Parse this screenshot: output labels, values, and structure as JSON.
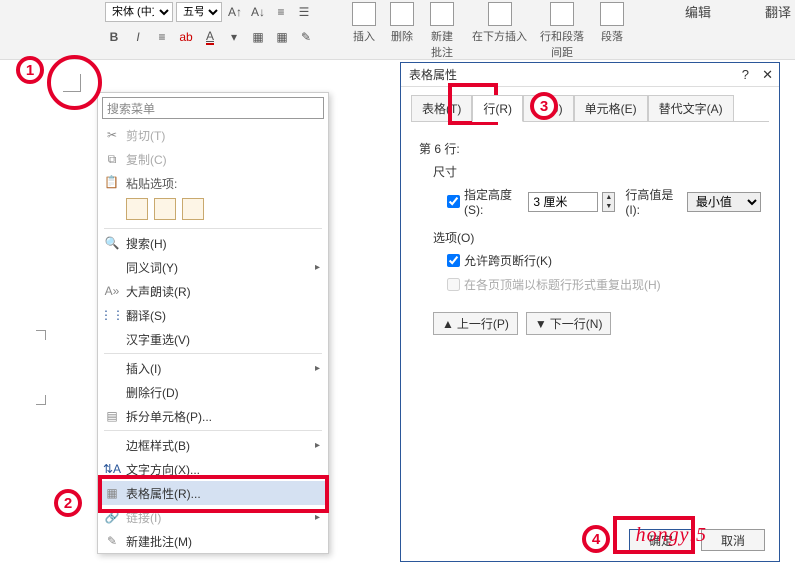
{
  "ribbon": {
    "font_name": "宋体 (中文",
    "font_size": "五号",
    "groups": {
      "insert": "插入",
      "delete": "删除",
      "new_comment": "新建\n批注",
      "insert_below": "在下方插入",
      "row_spacing": "行和段落\n间距",
      "paragraph": "段落"
    },
    "tabs": {
      "edit": "编辑",
      "trans": "翻译"
    }
  },
  "context_menu": {
    "search_placeholder": "搜索菜单",
    "cut": "剪切(T)",
    "copy": "复制(C)",
    "paste_label": "粘贴选项:",
    "search": "搜索(H)",
    "synonyms": "同义词(Y)",
    "read_aloud": "大声朗读(R)",
    "translate": "翻译(S)",
    "cjk_reselect": "汉字重选(V)",
    "insert": "插入(I)",
    "delete_row": "删除行(D)",
    "split_cells": "拆分单元格(P)...",
    "border_style": "边框样式(B)",
    "text_direction": "文字方向(X)...",
    "table_props": "表格属性(R)...",
    "link": "链接(I)",
    "new_comment": "新建批注(M)"
  },
  "dialog": {
    "title": "表格属性",
    "tabs": {
      "table": "表格(T)",
      "row": "行(R)",
      "column": "列(U)",
      "cell": "单元格(E)",
      "alt_text": "替代文字(A)"
    },
    "row_header": "第 6 行:",
    "size_label": "尺寸",
    "spec_height": "指定高度(S):",
    "height_value": "3 厘米",
    "height_is": "行高值是(I):",
    "height_mode": "最小值",
    "options_label": "选项(O)",
    "allow_break": "允许跨页断行(K)",
    "repeat_header": "在各页顶端以标题行形式重复出现(H)",
    "prev_row": "上一行(P)",
    "next_row": "下一行(N)",
    "ok": "确定",
    "cancel": "取消"
  },
  "watermark": "hongyi5"
}
